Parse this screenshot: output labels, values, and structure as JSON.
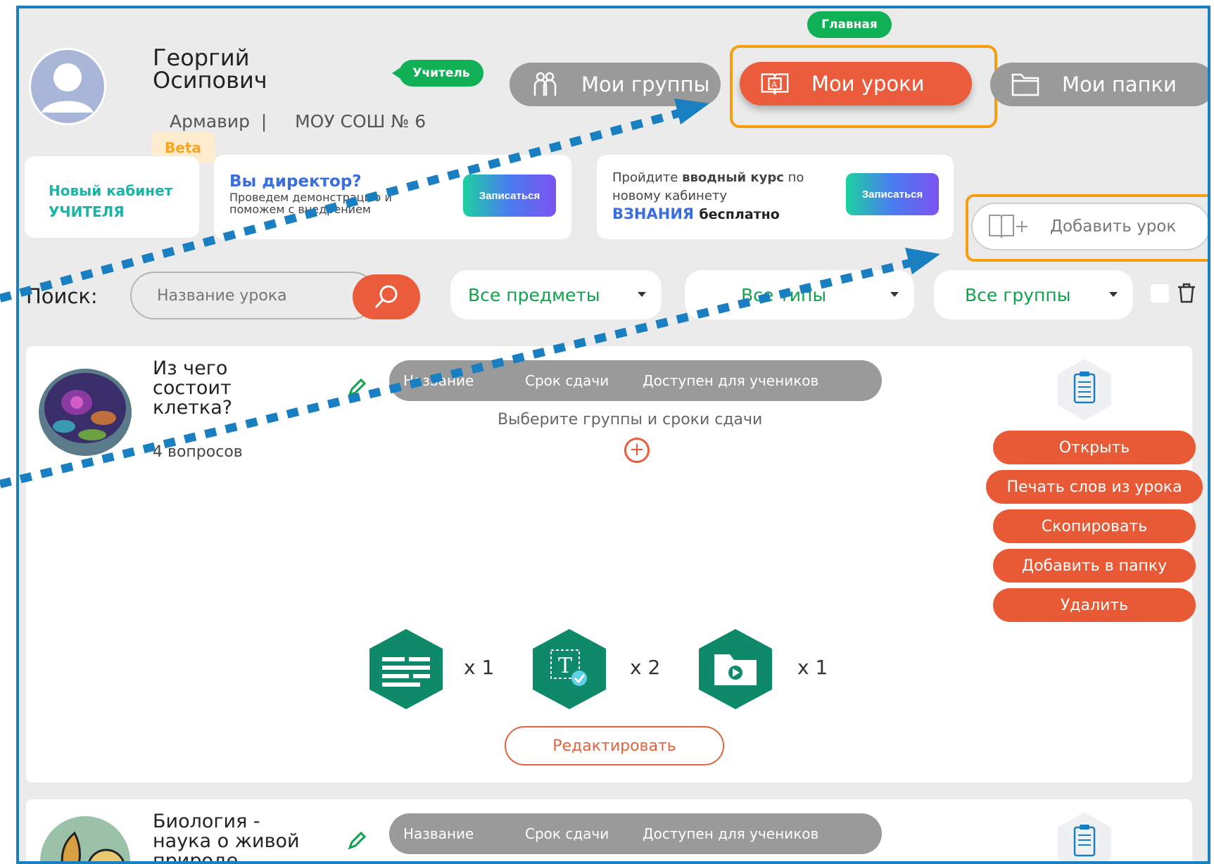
{
  "profile": {
    "name": "Георгий Осипович",
    "role_badge": "Учитель",
    "city": "Армавир",
    "separator": "|",
    "school": "МОУ СОШ № 6"
  },
  "nav": {
    "main_badge": "Главная",
    "tabs": [
      {
        "label": "Мои группы",
        "icon": "groups-icon"
      },
      {
        "label": "Мои уроки",
        "icon": "book-icon",
        "active": true
      },
      {
        "label": "Мои папки",
        "icon": "folder-icon"
      }
    ]
  },
  "banners": {
    "beta": "Beta",
    "new_cabinet_line1": "Новый кабинет",
    "new_cabinet_line2": "УЧИТЕЛЯ",
    "director_title": "Вы директор?",
    "director_text": "Проведем демонстрацию и поможем с внедрением",
    "course_prefix": "Пройдите",
    "course_bold": "вводный курс",
    "course_suffix": "по новому кабинету",
    "course_brand": "ВЗНАНИЯ",
    "course_free": "бесплатно",
    "signup_label": "Записаться"
  },
  "add_lesson": {
    "label": "Добавить урок"
  },
  "search": {
    "label": "Поиск:",
    "placeholder": "Название урока"
  },
  "filters": {
    "subjects": "Все предметы",
    "types": "Все типы",
    "groups": "Все группы"
  },
  "lessons": [
    {
      "title": "Из чего состоит клетка?",
      "questions": "4 вопросов",
      "table_headers": [
        "Название",
        "Срок сдачи",
        "Доступен для учеников"
      ],
      "empty_text": "Выберите группы и сроки сдачи",
      "actions": [
        "Открыть",
        "Печать слов из урока",
        "Скопировать",
        "Добавить в папку",
        "Удалить"
      ],
      "content_counts": [
        {
          "icon": "text-block-icon",
          "count": "x 1"
        },
        {
          "icon": "text-check-icon",
          "count": "x 2"
        },
        {
          "icon": "video-folder-icon",
          "count": "x 1"
        }
      ],
      "edit_label": "Редактировать"
    },
    {
      "title": "Биология - наука о живой природе",
      "table_headers": [
        "Название",
        "Срок сдачи",
        "Доступен для учеников"
      ]
    }
  ],
  "colors": {
    "frame_border": "#1a7fc1",
    "accent_orange": "#ea5c3b",
    "green": "#10b156",
    "highlight": "#f59f0f",
    "teal_hex": "#0e8a6a"
  }
}
